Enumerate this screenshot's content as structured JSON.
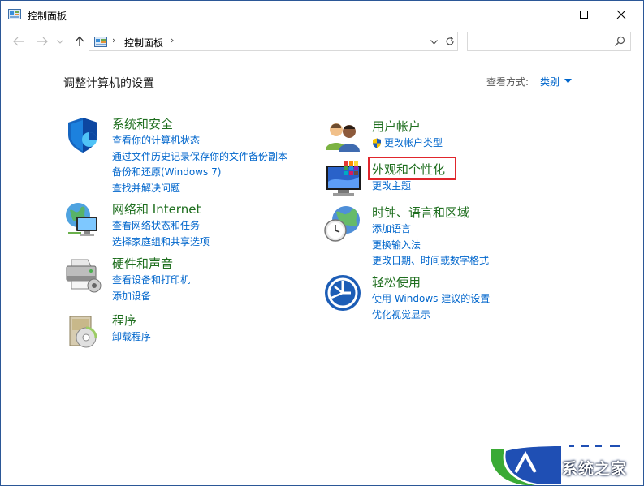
{
  "window": {
    "title": "控制面板",
    "icon": "control-panel-icon"
  },
  "address": {
    "path": "控制面板",
    "separator": "›",
    "search_placeholder": ""
  },
  "main": {
    "heading": "调整计算机的设置",
    "view_by_label": "查看方式:",
    "view_by_value": "类别"
  },
  "categories": {
    "system": {
      "title": "系统和安全",
      "icon": "shield-icon",
      "links": [
        "查看你的计算机状态",
        "通过文件历史记录保存你的文件备份副本",
        "备份和还原(Windows 7)",
        "查找并解决问题"
      ]
    },
    "network": {
      "title": "网络和 Internet",
      "icon": "globe-network-icon",
      "links": [
        "查看网络状态和任务",
        "选择家庭组和共享选项"
      ]
    },
    "hardware": {
      "title": "硬件和声音",
      "icon": "printer-icon",
      "links": [
        "查看设备和打印机",
        "添加设备"
      ]
    },
    "programs": {
      "title": "程序",
      "icon": "programs-icon",
      "links": [
        "卸载程序"
      ]
    },
    "accounts": {
      "title": "用户帐户",
      "icon": "users-icon",
      "links": [
        "更改帐户类型"
      ]
    },
    "appearance": {
      "title": "外观和个性化",
      "icon": "monitor-palette-icon",
      "links": [
        "更改主题"
      ]
    },
    "clock": {
      "title": "时钟、语言和区域",
      "icon": "clock-globe-icon",
      "links": [
        "添加语言",
        "更换输入法",
        "更改日期、时间或数字格式"
      ]
    },
    "ease": {
      "title": "轻松使用",
      "icon": "ease-of-access-icon",
      "links": [
        "使用 Windows 建议的设置",
        "优化视觉显示"
      ]
    }
  },
  "watermark": {
    "text": "系统之家"
  },
  "colors": {
    "link": "#0066cc",
    "category_title": "#1e6e1e",
    "highlight": "#e0262c"
  }
}
